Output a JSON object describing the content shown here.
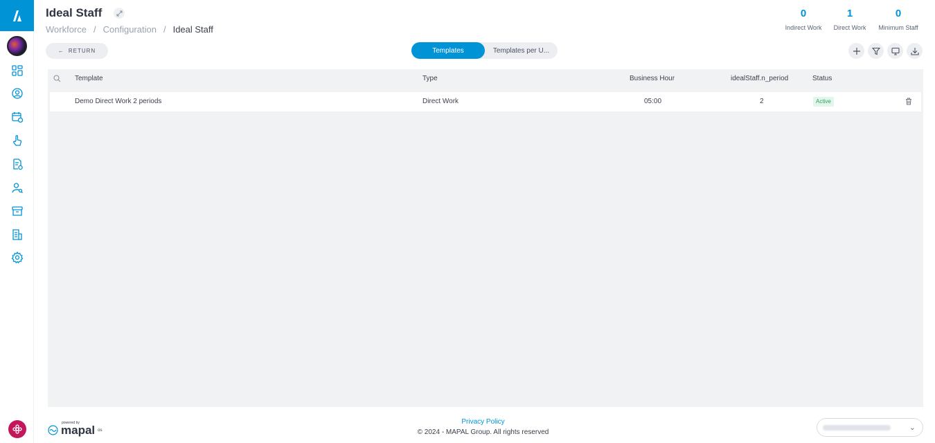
{
  "header": {
    "title": "Ideal Staff",
    "breadcrumb": [
      "Workforce",
      "Configuration",
      "Ideal Staff"
    ],
    "separator": "/"
  },
  "stats": [
    {
      "value": "0",
      "label": "Indirect Work"
    },
    {
      "value": "1",
      "label": "Direct Work"
    },
    {
      "value": "0",
      "label": "Minimum Staff"
    }
  ],
  "toolbar": {
    "return_label": "RETURN",
    "tabs": [
      {
        "label": "Templates",
        "active": true
      },
      {
        "label": "Templates per U...",
        "active": false
      }
    ],
    "actions": [
      "plus-icon",
      "filter-icon",
      "monitor-icon",
      "download-icon"
    ]
  },
  "table": {
    "columns": [
      "Template",
      "Type",
      "Business Hour",
      "idealStaff.n_period",
      "Status"
    ],
    "rows": [
      {
        "template": "Demo Direct Work 2 periods",
        "type": "Direct Work",
        "business_hour": "05:00",
        "n_period": "2",
        "status": "Active"
      }
    ]
  },
  "footer": {
    "powered_by": "powered by",
    "brand": "mapal",
    "brand_suffix": "os",
    "privacy": "Privacy Policy",
    "copyright": "© 2024 - MAPAL Group. All rights reserved"
  },
  "colors": {
    "accent": "#0093d6",
    "status_active_bg": "#e3f6ec",
    "status_active_text": "#2e9e5a"
  },
  "sidebar": {
    "icons": [
      "dashboard-icon",
      "user-circle-icon",
      "calendar-clock-icon",
      "hand-pointer-icon",
      "document-clock-icon",
      "user-search-icon",
      "archive-icon",
      "document-list-icon",
      "settings-icon"
    ]
  }
}
